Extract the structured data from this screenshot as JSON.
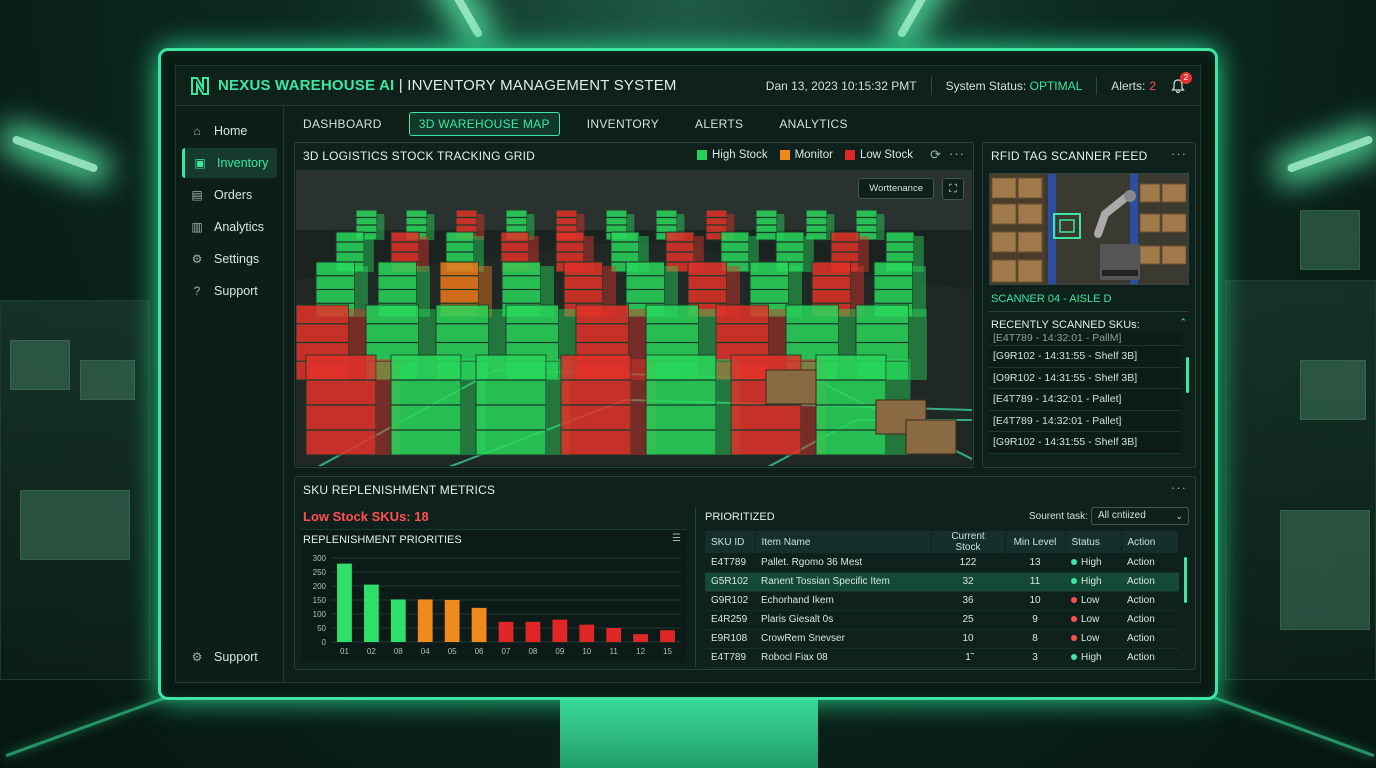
{
  "header": {
    "brand": "NEXUS WAREHOUSE AI",
    "subtitle": "| INVENTORY MANAGEMENT SYSTEM",
    "datetime": "Dan 13, 2023 10:15:32 PMT",
    "status_label": "System Status:",
    "status_value": "OPTIMAL",
    "alerts_label": "Alerts:",
    "alerts_count": "2",
    "bell_badge": "2"
  },
  "sidebar": {
    "items": [
      {
        "label": "Home",
        "icon": "home-icon"
      },
      {
        "label": "Inventory",
        "icon": "inventory-icon",
        "active": true
      },
      {
        "label": "Orders",
        "icon": "orders-icon"
      },
      {
        "label": "Analytics",
        "icon": "analytics-icon"
      },
      {
        "label": "Settings",
        "icon": "gear-icon"
      },
      {
        "label": "Support",
        "icon": "help-icon"
      }
    ],
    "bottom": {
      "label": "Support",
      "icon": "gear-icon"
    }
  },
  "tabs": [
    "DASHBOARD",
    "3D WAREHOUSE MAP",
    "INVENTORY",
    "ALERTS",
    "ANALYTICS"
  ],
  "map": {
    "title": "3D LOGISTICS STOCK TRACKING GRID",
    "legend": [
      {
        "label": "High Stock",
        "color": "#27d05a"
      },
      {
        "label": "Monitor",
        "color": "#f08a1c"
      },
      {
        "label": "Low Stock",
        "color": "#e02626"
      }
    ],
    "maintenance_btn": "Worttenance"
  },
  "rfid": {
    "title": "RFID TAG SCANNER FEED",
    "scanner": "SCANNER 04 - AISLE D",
    "recent_title": "RECENTLY SCANNED SKUs:",
    "scans": [
      "[E4T789 - 14:32:01 - PallM]",
      "[G9R102 - 14:31:55 - Shelf 3B]",
      "[O9R102 - 14:31:55 - Shelf 3B]",
      "[E4T789 - 14:32:01 - Pallet]",
      "[E4T789 - 14:32:01 - Pallet]",
      "[G9R102 - 14:31:55 - Shelf 3B]"
    ]
  },
  "metrics": {
    "title": "SKU REPLENISHMENT METRICS",
    "low_stock": "Low Stock SKUs: 18",
    "prioritized_title": "PRIORITIZED",
    "sort_label": "Sourent task:",
    "sort_value": "All cntiized"
  },
  "chart_data": {
    "type": "bar",
    "title": "REPLENISHMENT PRIORITIES",
    "categories": [
      "01",
      "02",
      "08",
      "04",
      "05",
      "06",
      "07",
      "08",
      "09",
      "10",
      "11",
      "12",
      "15"
    ],
    "values": [
      280,
      205,
      152,
      152,
      150,
      122,
      72,
      72,
      80,
      62,
      50,
      28,
      42
    ],
    "colors": [
      "#2ee06a",
      "#2ee06a",
      "#2ee06a",
      "#f08a1c",
      "#f08a1c",
      "#f08a1c",
      "#e02626",
      "#e02626",
      "#e02626",
      "#e02626",
      "#e02626",
      "#e02626",
      "#e02626"
    ],
    "yticks": [
      0,
      50,
      100,
      150,
      200,
      250,
      300
    ],
    "ylim": [
      0,
      300
    ],
    "grid": true
  },
  "table": {
    "headers": [
      "SKU ID",
      "Item Name",
      "Current Stock",
      "Min Level",
      "Status",
      "Action"
    ],
    "rows": [
      {
        "sku": "E4T789",
        "name": "Pallet. Rgomo 36 Mest",
        "stock": "122",
        "min": "13",
        "status": "High",
        "action": "Action"
      },
      {
        "sku": "G5R102",
        "name": "Ranent Tossian Specific Item",
        "stock": "32",
        "min": "11",
        "status": "High",
        "action": "Action",
        "highlight": true
      },
      {
        "sku": "G9R102",
        "name": "Echorhand Ikem",
        "stock": "36",
        "min": "10",
        "status": "Low",
        "action": "Action"
      },
      {
        "sku": "E4R259",
        "name": "Plaris Giesalt 0s",
        "stock": "25",
        "min": "9",
        "status": "Low",
        "action": "Action"
      },
      {
        "sku": "E9R108",
        "name": "CrowRem Snevser",
        "stock": "10",
        "min": "8",
        "status": "Low",
        "action": "Action"
      },
      {
        "sku": "E4T789",
        "name": "Robocl Fiax 08",
        "stock": "1̃",
        "min": "3",
        "status": "High",
        "action": "Action"
      }
    ]
  },
  "colors": {
    "accent": "#3ee6a2",
    "danger": "#ff5050",
    "warn": "#f08a1c"
  }
}
